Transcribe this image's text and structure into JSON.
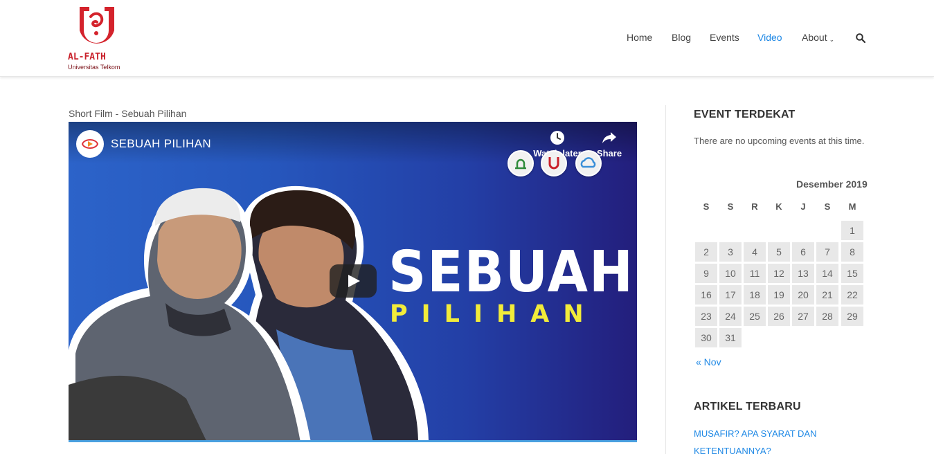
{
  "header": {
    "logo_name": "AL-FATH",
    "logo_sub": "Universitas Telkom",
    "brand_color": "#c9202a",
    "nav": [
      {
        "label": "Home",
        "active": false
      },
      {
        "label": "Blog",
        "active": false
      },
      {
        "label": "Events",
        "active": false
      },
      {
        "label": "Video",
        "active": true
      },
      {
        "label": "About",
        "active": false,
        "has_dropdown": true
      }
    ],
    "search_icon": "search-icon",
    "accent_color": "#1e88e5"
  },
  "main": {
    "post_title": "Short Film - Sebuah Pilihan",
    "video": {
      "title": "SEBUAH PILIHAN",
      "watch_later": "Watch later",
      "share": "Share",
      "thumb_big": "SEBUAH",
      "thumb_small": "PILIHAN",
      "play_icon": "play-icon"
    }
  },
  "sidebar": {
    "event_title": "EVENT TERDEKAT",
    "no_events": "There are no upcoming events at this time.",
    "calendar": {
      "caption": "Desember 2019",
      "days": [
        "S",
        "S",
        "R",
        "K",
        "J",
        "S",
        "M"
      ],
      "weeks": [
        [
          "",
          "",
          "",
          "",
          "",
          "",
          "1"
        ],
        [
          "2",
          "3",
          "4",
          "5",
          "6",
          "7",
          "8"
        ],
        [
          "9",
          "10",
          "11",
          "12",
          "13",
          "14",
          "15"
        ],
        [
          "16",
          "17",
          "18",
          "19",
          "20",
          "21",
          "22"
        ],
        [
          "23",
          "24",
          "25",
          "26",
          "27",
          "28",
          "29"
        ],
        [
          "30",
          "31",
          "",
          "",
          "",
          "",
          ""
        ]
      ],
      "prev": "« Nov"
    },
    "articles_title": "ARTIKEL TERBARU",
    "articles": [
      "MUSAFIR? APA SYARAT DAN",
      "KETENTUANNYA?"
    ]
  }
}
